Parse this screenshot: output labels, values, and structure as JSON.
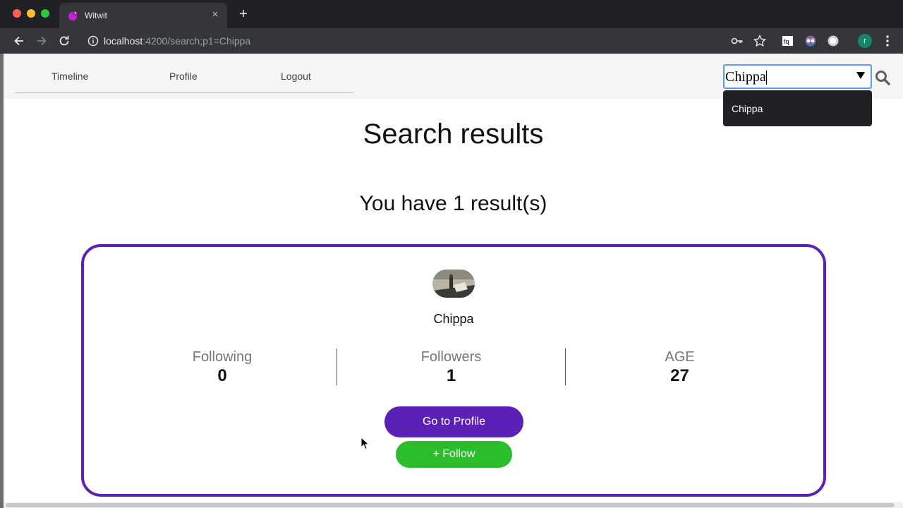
{
  "browser": {
    "tab_title": "Witwit",
    "tab_close": "×",
    "new_tab": "+",
    "url_host": "localhost",
    "url_rest": ":4200/search;p1=Chippa",
    "profile_initial": "r"
  },
  "nav": {
    "links": [
      "Timeline",
      "Profile",
      "Logout"
    ]
  },
  "search": {
    "value": "Chippa",
    "suggestions": [
      "Chippa"
    ]
  },
  "main": {
    "title": "Search results",
    "result_count": "You have 1 result(s)"
  },
  "result": {
    "username": "Chippa",
    "stats": [
      {
        "label": "Following",
        "value": "0"
      },
      {
        "label": "Followers",
        "value": "1"
      },
      {
        "label": "AGE",
        "value": "27"
      }
    ],
    "go_to_profile_label": "Go to Profile",
    "follow_label": "+ Follow"
  },
  "colors": {
    "brand_purple": "#5b21b6",
    "follow_green": "#2bbd2b",
    "focus_blue": "#5b9ee9"
  }
}
